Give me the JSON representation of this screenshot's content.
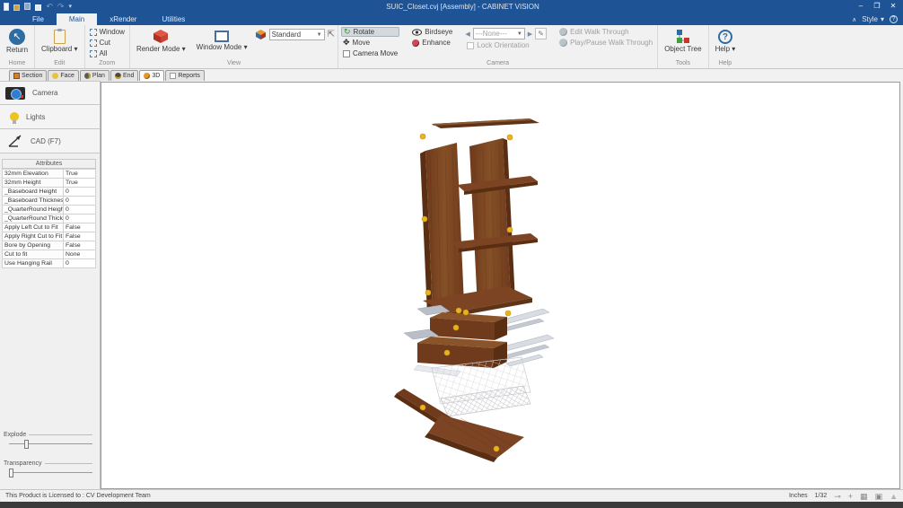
{
  "window": {
    "title": "SUIC_Closet.cvj [Assembly] - CABINET VISION",
    "controls": {
      "minimize": "–",
      "restore": "❐",
      "close": "✕"
    },
    "quick_access_icons": [
      "new-document",
      "open-folder",
      "save",
      "print",
      "undo",
      "redo",
      "more"
    ]
  },
  "menu": {
    "tabs": [
      {
        "label": "File"
      },
      {
        "label": "Main",
        "active": true
      },
      {
        "label": "xRender"
      },
      {
        "label": "Utilities"
      }
    ],
    "style_label": "Style",
    "collapse_glyph": "∧",
    "style_caret": "▾"
  },
  "ribbon": {
    "home": {
      "group_label": "Home",
      "return_label": "Return"
    },
    "edit": {
      "group_label": "Edit",
      "clipboard_label": "Clipboard ▾"
    },
    "zoom": {
      "group_label": "Zoom",
      "items": [
        "Window",
        "Cut",
        "All"
      ]
    },
    "view": {
      "group_label": "View",
      "render_mode_label": "Render Mode ▾",
      "window_mode_label": "Window Mode ▾",
      "standard_value": "Standard"
    },
    "camera": {
      "group_label": "Camera",
      "rotate_label": "Rotate",
      "move_label": "Move",
      "camera_move_label": "Camera Move",
      "birdseye_label": "Birdseye",
      "enhance_label": "Enhance",
      "camera_select_value": "---None---",
      "lock_orientation_label": "Lock Orientation",
      "edit_walkthrough_label": "Edit Walk Through",
      "play_walkthrough_label": "Play/Pause Walk Through"
    },
    "tools": {
      "group_label": "Tools",
      "object_tree_label": "Object Tree"
    },
    "help": {
      "group_label": "Help",
      "help_label": "Help ▾"
    }
  },
  "view_tabs": [
    {
      "label": "Section"
    },
    {
      "label": "Face"
    },
    {
      "label": "Plan"
    },
    {
      "label": "End"
    },
    {
      "label": "3D",
      "active": true
    },
    {
      "label": "Reports"
    }
  ],
  "sidebar": {
    "buttons": [
      {
        "label": "Camera",
        "icon": "camera-icon"
      },
      {
        "label": "Lights",
        "icon": "lightbulb-icon"
      },
      {
        "label": "CAD (F7)",
        "icon": "cad-arrow-icon"
      }
    ],
    "attributes_title": "Attributes",
    "attributes": [
      {
        "name": "32mm Elevation",
        "value": "True"
      },
      {
        "name": "32mm Height",
        "value": "True"
      },
      {
        "name": "_Baseboard Height",
        "value": "0"
      },
      {
        "name": "_Baseboard Thickness",
        "value": "0"
      },
      {
        "name": "_QuarterRound Height",
        "value": "0"
      },
      {
        "name": "_QuarterRound Thickness",
        "value": "0"
      },
      {
        "name": "Apply Left Cut to Fit",
        "value": "False"
      },
      {
        "name": "Apply Right Cut to Fit",
        "value": "False"
      },
      {
        "name": "Bore by Opening",
        "value": "False"
      },
      {
        "name": "Cut to fit",
        "value": "None"
      },
      {
        "name": "Use Hanging Rail",
        "value": "0"
      }
    ],
    "explode_label": "Explode",
    "explode_percent": 20,
    "transparency_label": "Transparency",
    "transparency_percent": 2
  },
  "viewport": {
    "content": "Exploded 3D view of wooden closet assembly: top shelf, two vertical gables, two side shelves, two drawer boxes with metal slides, wire basket, two angled bottom panels, yellow cam fittings"
  },
  "statusbar": {
    "license_text": "This Product is Licensed to : CV Development Team",
    "units": "Inches",
    "scale": "1/32",
    "icons": [
      "snap-icon",
      "crosshair-icon",
      "grid-icon",
      "frame-icon",
      "triangle-icon"
    ]
  },
  "colors": {
    "titlebar_blue": "#1e5395",
    "ribbon_bg": "#f1f1f1",
    "wood_light": "#8a5329",
    "wood_mid": "#7c4423",
    "wood_dark": "#5a2e13",
    "hardware_yellow": "#e8b41e",
    "slide_silver": "#c3c8d1",
    "selection_gray": "#d5d9dc"
  }
}
